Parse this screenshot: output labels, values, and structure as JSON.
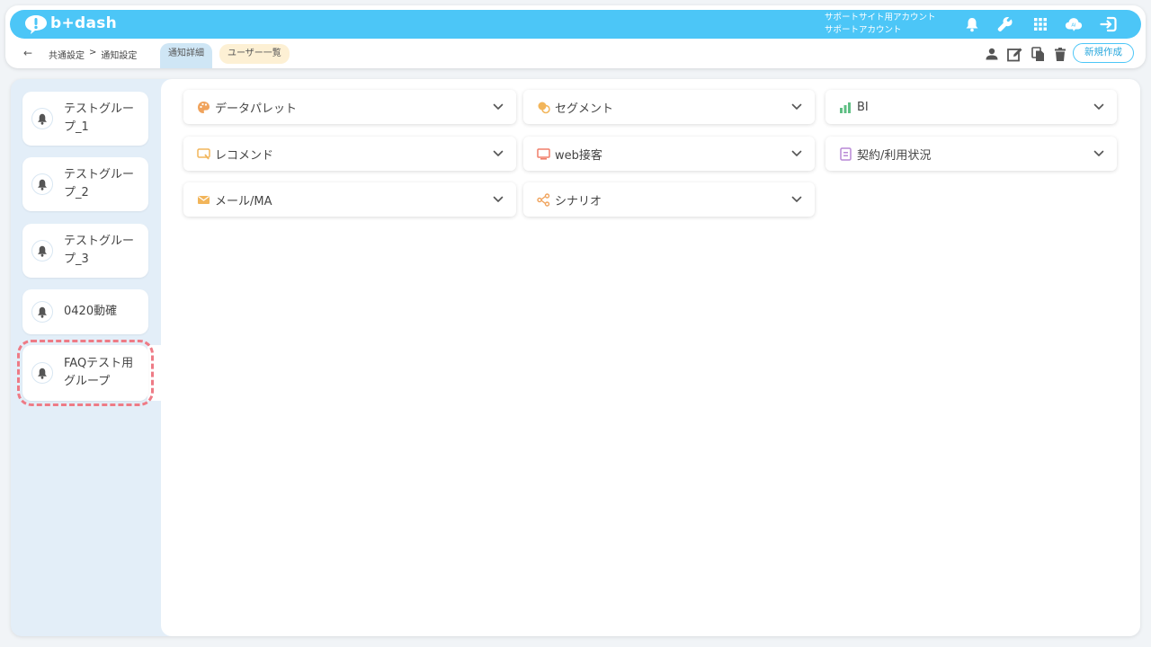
{
  "app": {
    "logo_text": "b+dash"
  },
  "account": {
    "line1": "サポートサイト用アカウント",
    "line2": "サポートアカウント"
  },
  "topbar_icons": [
    "bell-icon",
    "wrench-icon",
    "grid-icon",
    "cloud-icon",
    "logout-icon"
  ],
  "breadcrumb": {
    "back": "←",
    "part1": "共通設定",
    "sep": ">",
    "part2": "通知設定"
  },
  "tabs": {
    "detail": "通知詳細",
    "users": "ユーザー一覧"
  },
  "subbar_icons": [
    "user-icon",
    "edit-icon",
    "copy-icon",
    "trash-icon"
  ],
  "new_button": "新規作成",
  "groups": [
    {
      "label": "テストグループ_1"
    },
    {
      "label": "テストグループ_2"
    },
    {
      "label": "テストグループ_3"
    },
    {
      "label": "0420動確"
    },
    {
      "label": "FAQテスト用グループ",
      "selected": true
    }
  ],
  "categories": [
    {
      "label": "データパレット",
      "icon": "palette-icon",
      "color": "#f0a35c"
    },
    {
      "label": "セグメント",
      "icon": "segment-icon",
      "color": "#f2b55a"
    },
    {
      "label": "BI",
      "icon": "bi-chart-icon",
      "color": "#5fbf84"
    },
    {
      "label": "レコメンド",
      "icon": "recommend-icon",
      "color": "#f2b55a"
    },
    {
      "label": "web接客",
      "icon": "web-icon",
      "color": "#f07f6a"
    },
    {
      "label": "契約/利用状況",
      "icon": "contract-icon",
      "color": "#b889d6"
    },
    {
      "label": "メール/MA",
      "icon": "mail-icon",
      "color": "#f2b55a"
    },
    {
      "label": "シナリオ",
      "icon": "scenario-icon",
      "color": "#f0a35c"
    }
  ],
  "colors": {
    "brand": "#4cc6f7",
    "sidebar_bg": "#e3eef8",
    "selected_outline": "#ee7b86"
  }
}
